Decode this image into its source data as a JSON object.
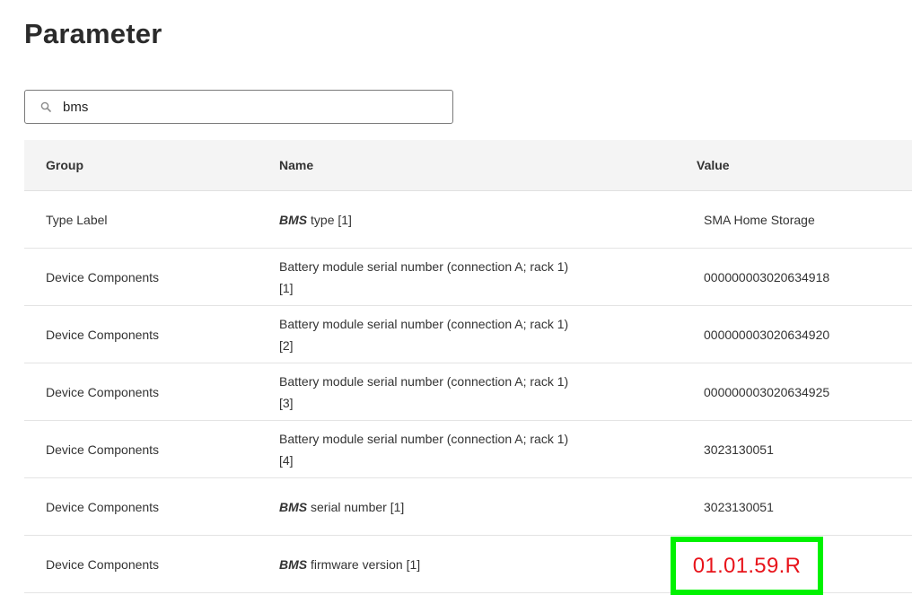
{
  "page": {
    "title": "Parameter"
  },
  "search": {
    "value": "bms",
    "icon": "search-icon"
  },
  "table": {
    "columns": [
      "Group",
      "Name",
      "Value"
    ],
    "rows": [
      {
        "group": "Type Label",
        "name_prefix": "BMS",
        "name_rest": " type [1]",
        "name_line2": "",
        "value": "SMA Home Storage"
      },
      {
        "group": "Device Components",
        "name_prefix": "",
        "name_rest": "Battery module serial number (connection A; rack 1)",
        "name_line2": "[1]",
        "value": "000000003020634918"
      },
      {
        "group": "Device Components",
        "name_prefix": "",
        "name_rest": "Battery module serial number (connection A; rack 1)",
        "name_line2": "[2]",
        "value": "000000003020634920"
      },
      {
        "group": "Device Components",
        "name_prefix": "",
        "name_rest": "Battery module serial number (connection A; rack 1)",
        "name_line2": "[3]",
        "value": "000000003020634925"
      },
      {
        "group": "Device Components",
        "name_prefix": "",
        "name_rest": "Battery module serial number (connection A; rack 1)",
        "name_line2": "[4]",
        "value": "3023130051"
      },
      {
        "group": "Device Components",
        "name_prefix": "BMS",
        "name_rest": " serial number [1]",
        "name_line2": "",
        "value": "3023130051"
      },
      {
        "group": "Device Components",
        "name_prefix": "BMS",
        "name_rest": " firmware version [1]",
        "name_line2": "",
        "value": "01.01.59.R"
      }
    ]
  },
  "highlight": {
    "border_color": "#00f200",
    "text_color": "#e8141b"
  }
}
